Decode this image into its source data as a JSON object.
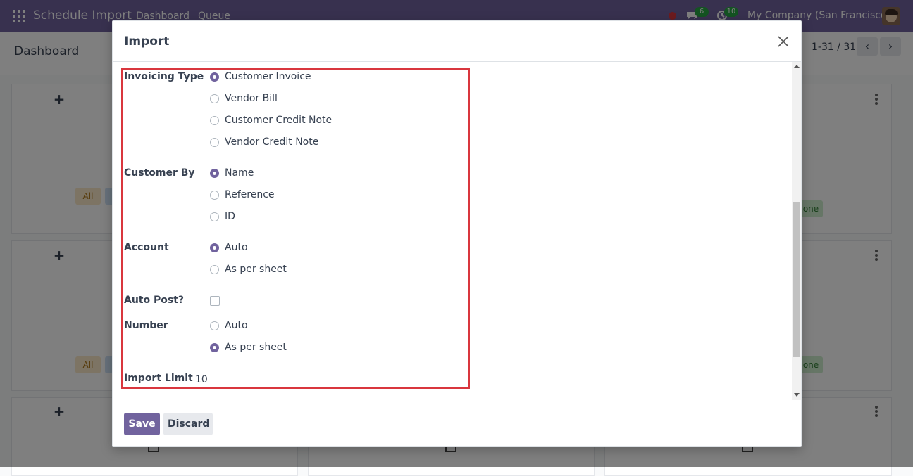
{
  "navbar": {
    "app_title": "Schedule Import",
    "menu": [
      "Dashboard",
      "Queue"
    ],
    "messages_count": "6",
    "activities_count": "10",
    "company": "My Company (San Francisco)"
  },
  "control_panel": {
    "title": "Dashboard",
    "pager": "1-31 / 31"
  },
  "background": {
    "tag_all": "All",
    "tag_done": "one"
  },
  "modal": {
    "title": "Import",
    "fields": {
      "invoicing_type": {
        "label": "Invoicing Type",
        "options": [
          "Customer Invoice",
          "Vendor Bill",
          "Customer Credit Note",
          "Vendor Credit Note"
        ],
        "selected": "Customer Invoice"
      },
      "customer_by": {
        "label": "Customer By",
        "options": [
          "Name",
          "Reference",
          "ID"
        ],
        "selected": "Name"
      },
      "account": {
        "label": "Account",
        "options": [
          "Auto",
          "As per sheet"
        ],
        "selected": "Auto"
      },
      "auto_post": {
        "label": "Auto Post?",
        "checked": false
      },
      "number": {
        "label": "Number",
        "options": [
          "Auto",
          "As per sheet"
        ],
        "selected": "As per sheet"
      },
      "import_limit": {
        "label": "Import Limit",
        "value": "10"
      }
    },
    "footer": {
      "save_label": "Save",
      "discard_label": "Discard"
    }
  },
  "colors": {
    "brand": "#71639e",
    "highlight": "#d9363e"
  }
}
